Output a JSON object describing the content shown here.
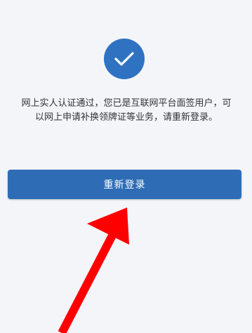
{
  "status": {
    "icon": "checkmark-icon",
    "accent_color": "#2f72c2"
  },
  "message": {
    "text": "网上实人认证通过，您已是互联网平台面签用户，可以网上申请补换领牌证等业务，请重新登录。"
  },
  "actions": {
    "relogin_label": "重新登录",
    "button_color": "#2e6db5"
  },
  "annotation": {
    "icon": "red-arrow-icon",
    "color": "#ff0000"
  }
}
